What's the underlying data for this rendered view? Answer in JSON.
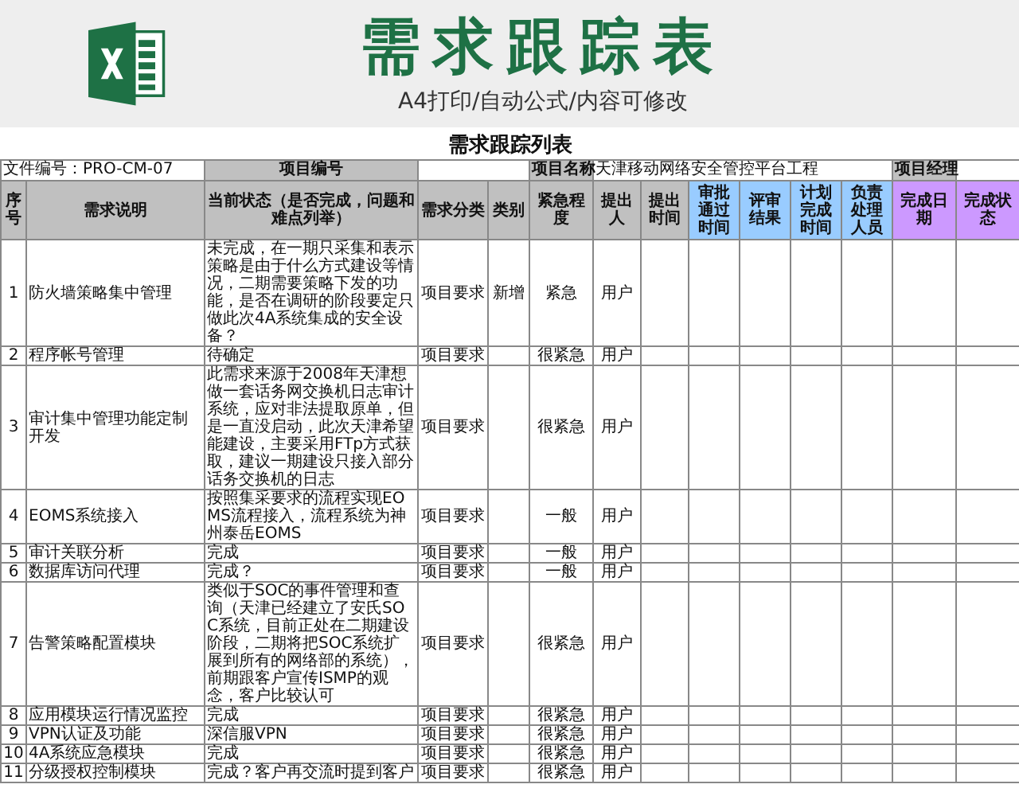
{
  "banner": {
    "title": "需求跟踪表",
    "subtitle": "A4打印/自动公式/内容可修改"
  },
  "sheet": {
    "title": "需求跟踪列表",
    "info": {
      "file_number": "文件编号：PRO-CM-07",
      "project_number_label": "项目编号",
      "project_name_label": "项目名称",
      "project_name": "天津移动网络安全管控平台工程",
      "project_manager_label": "项目经理"
    },
    "columns": [
      {
        "label": "序号",
        "color": "#c0c0c0"
      },
      {
        "label": "需求说明",
        "color": "#c0c0c0"
      },
      {
        "label": "当前状态（是否完成，问题和难点列举）",
        "color": "#c0c0c0"
      },
      {
        "label": "需求分类",
        "color": "#c0c0c0"
      },
      {
        "label": "类别",
        "color": "#c0c0c0"
      },
      {
        "label": "紧急程度",
        "color": "#c0c0c0"
      },
      {
        "label": "提出人",
        "color": "#c0c0c0"
      },
      {
        "label": "提出时间",
        "color": "#c0c0c0"
      },
      {
        "label": "审批通过时间",
        "color": "#99ccff"
      },
      {
        "label": "评审结果",
        "color": "#99ccff"
      },
      {
        "label": "计划完成时间",
        "color": "#99ccff"
      },
      {
        "label": "负责处理人员",
        "color": "#99ccff"
      },
      {
        "label": "完成日期",
        "color": "#cc99ff"
      },
      {
        "label": "完成状态",
        "color": "#cc99ff"
      }
    ],
    "rows": [
      {
        "no": "1",
        "description": "防火墙策略集中管理",
        "status": "未完成，在一期只采集和表示策略是由于什么方式建设等情况，二期需要策略下发的功能，是否在调研的阶段要定只做此次4A系统集成的安全设备？",
        "category": "项目要求",
        "type": "新增",
        "urgency": "紧急",
        "proposer": "用户"
      },
      {
        "no": "2",
        "description": "程序帐号管理",
        "status": "待确定",
        "category": "项目要求",
        "urgency": "很紧急",
        "proposer": "用户"
      },
      {
        "no": "3",
        "description": "审计集中管理功能定制开发",
        "status": "此需求来源于2008年天津想做一套话务网交换机日志审计系统，应对非法提取原单，但是一直没启动，此次天津希望能建设，主要采用FTp方式获取，建议一期建设只接入部分话务交换机的日志",
        "category": "项目要求",
        "urgency": "很紧急",
        "proposer": "用户"
      },
      {
        "no": "4",
        "description": "EOMS系统接入",
        "status": "按照集采要求的流程实现EOMS流程接入，流程系统为神州泰岳EOMS",
        "category": "项目要求",
        "urgency": "一般",
        "proposer": "用户"
      },
      {
        "no": "5",
        "description": "审计关联分析",
        "status": "完成",
        "category": "项目要求",
        "urgency": "一般",
        "proposer": "用户"
      },
      {
        "no": "6",
        "description": "数据库访问代理",
        "status": "完成？",
        "category": "项目要求",
        "urgency": "一般",
        "proposer": "用户"
      },
      {
        "no": "7",
        "description": "告警策略配置模块",
        "status": "类似于SOC的事件管理和查询（天津已经建立了安氏SOC系统，目前正处在二期建设阶段，二期将把SOC系统扩展到所有的网络部的系统），前期跟客户宣传ISMP的观念，客户比较认可",
        "category": "项目要求",
        "urgency": "很紧急",
        "proposer": "用户"
      },
      {
        "no": "8",
        "description": "应用模块运行情况监控",
        "status": "完成",
        "category": "项目要求",
        "urgency": "很紧急",
        "proposer": "用户"
      },
      {
        "no": "9",
        "description": "VPN认证及功能",
        "status": "深信服VPN",
        "category": "项目要求",
        "urgency": "很紧急",
        "proposer": "用户"
      },
      {
        "no": "10",
        "description": "4A系统应急模块",
        "status": "完成",
        "category": "项目要求",
        "urgency": "很紧急",
        "proposer": "用户"
      },
      {
        "no": "11",
        "description": "分级授权控制模块",
        "status": "完成？客户再交流时提到客户",
        "category": "项目要求",
        "urgency": "很紧急",
        "proposer": "用户"
      }
    ]
  }
}
